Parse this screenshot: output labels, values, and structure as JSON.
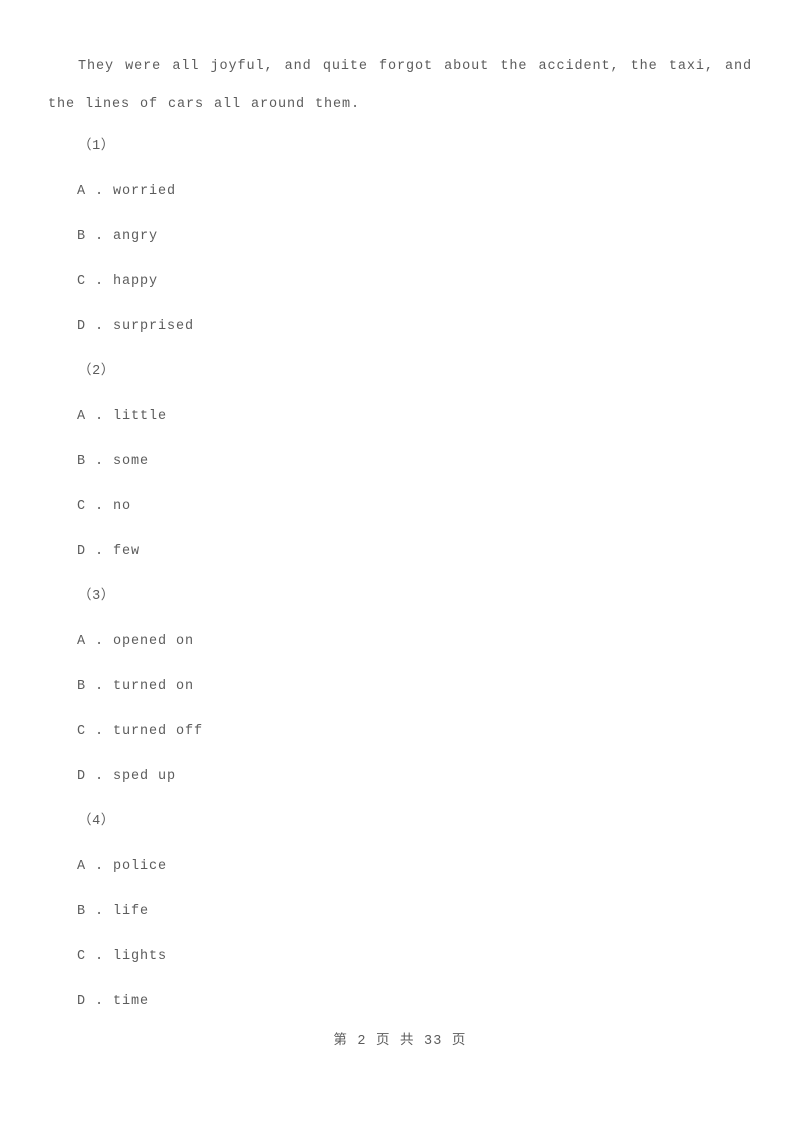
{
  "document": {
    "passage": "They were all joyful, and quite forgot about the accident, the taxi, and the lines of cars all around them.",
    "questions": [
      {
        "marker": "（1）",
        "options": [
          "A . worried",
          "B . angry",
          "C . happy",
          "D . surprised"
        ]
      },
      {
        "marker": "（2）",
        "options": [
          "A . little",
          "B . some",
          "C . no",
          "D . few"
        ]
      },
      {
        "marker": "（3）",
        "options": [
          "A . opened on",
          "B . turned on",
          "C . turned off",
          "D . sped up"
        ]
      },
      {
        "marker": "（4）",
        "options": [
          "A . police",
          "B . life",
          "C . lights",
          "D . time"
        ]
      }
    ],
    "footer": {
      "text": "第 2 页 共 33 页",
      "current_page": "2",
      "total_pages": "33"
    },
    "colors": {
      "text": "#5c5c5c",
      "background": "#ffffff"
    }
  }
}
